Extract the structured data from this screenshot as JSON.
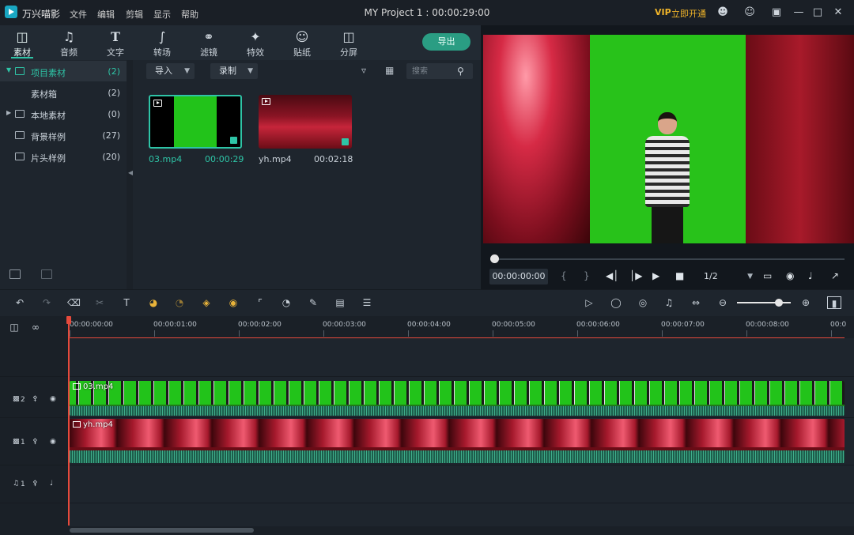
{
  "app": {
    "name": "万兴喵影",
    "menu": [
      "文件",
      "编辑",
      "剪辑",
      "显示",
      "帮助"
    ],
    "project_title": "MY Project 1 : 00:00:29:00",
    "vip_badge": "VIP",
    "vip_text": "立即开通"
  },
  "media_tabs": [
    {
      "label": "素材",
      "icon": "folder-icon"
    },
    {
      "label": "音频",
      "icon": "music-note-icon"
    },
    {
      "label": "文字",
      "icon": "text-icon"
    },
    {
      "label": "转场",
      "icon": "transition-icon"
    },
    {
      "label": "滤镜",
      "icon": "filter-icon"
    },
    {
      "label": "特效",
      "icon": "effects-icon"
    },
    {
      "label": "贴纸",
      "icon": "sticker-icon"
    },
    {
      "label": "分屏",
      "icon": "split-screen-icon"
    }
  ],
  "export_label": "导出",
  "sidebar": {
    "items": [
      {
        "label": "项目素材",
        "count": "(2)"
      },
      {
        "label": "素材箱",
        "count": "(2)"
      },
      {
        "label": "本地素材",
        "count": "(0)"
      },
      {
        "label": "背景样例",
        "count": "(27)"
      },
      {
        "label": "片头样例",
        "count": "(20)"
      }
    ]
  },
  "bin": {
    "import_label": "导入",
    "record_label": "录制",
    "search_placeholder": "搜索",
    "clips": [
      {
        "name": "03.mp4",
        "duration": "00:00:29"
      },
      {
        "name": "yh.mp4",
        "duration": "00:02:18"
      }
    ]
  },
  "preview": {
    "timecode": "00:00:00:00",
    "ratio": "1/2"
  },
  "timeline": {
    "ticks": [
      "00:00:00:00",
      "00:00:01:00",
      "00:00:02:00",
      "00:00:03:00",
      "00:00:04:00",
      "00:00:05:00",
      "00:00:06:00",
      "00:00:07:00",
      "00:00:08:00",
      "00:0"
    ],
    "tracks": [
      {
        "label": "2",
        "type": "video"
      },
      {
        "label": "1",
        "type": "video"
      },
      {
        "label": "1",
        "type": "audio"
      }
    ],
    "clips": [
      {
        "name": "03.mp4",
        "track": "2"
      },
      {
        "name": "yh.mp4",
        "track": "1"
      }
    ]
  },
  "colors": {
    "accent": "#2ec4a6",
    "playhead": "#e64a3c",
    "vip": "#f0b429"
  }
}
